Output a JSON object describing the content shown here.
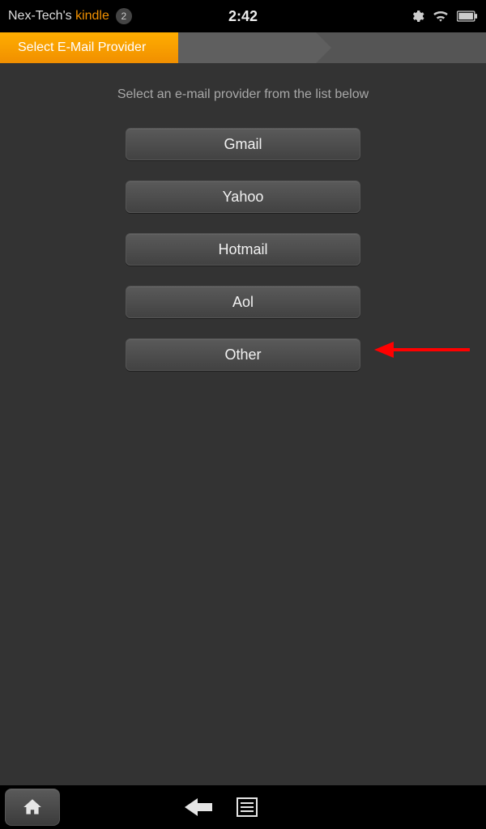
{
  "status": {
    "device_prefix": "Nex-Tech's ",
    "device_suffix": "kindle",
    "badge_count": "2",
    "clock": "2:42"
  },
  "breadcrumb": {
    "current_label": "Select E-Mail Provider"
  },
  "main": {
    "instruction": "Select an e-mail provider from the list below",
    "providers": [
      {
        "label": "Gmail"
      },
      {
        "label": "Yahoo"
      },
      {
        "label": "Hotmail"
      },
      {
        "label": "Aol"
      },
      {
        "label": "Other"
      }
    ]
  },
  "annotation": {
    "arrow_target_index": 4
  }
}
